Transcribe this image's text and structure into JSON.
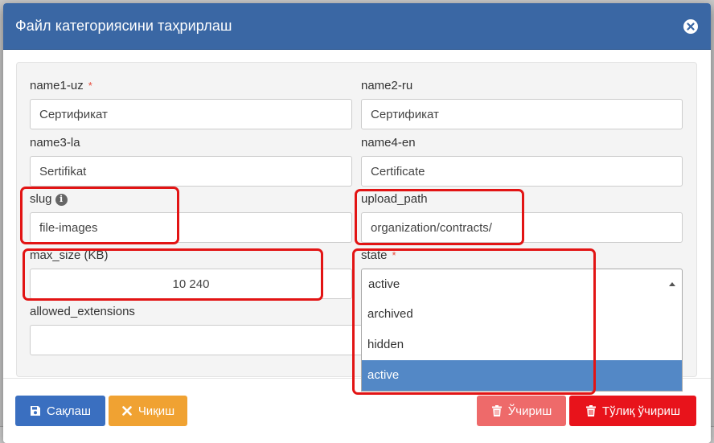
{
  "modal": {
    "title": "Файл категориясини таҳрирлаш"
  },
  "form": {
    "name1_uz": {
      "label": "name1-uz",
      "required": "*",
      "value": "Сертификат"
    },
    "name2_ru": {
      "label": "name2-ru",
      "value": "Сертификат"
    },
    "name3_la": {
      "label": "name3-la",
      "value": "Sertifikat"
    },
    "name4_en": {
      "label": "name4-en",
      "value": "Certificate"
    },
    "slug": {
      "label": "slug",
      "info": "i",
      "value": "file-images"
    },
    "upload_path": {
      "label": "upload_path",
      "value": "organization/contracts/"
    },
    "max_size": {
      "label": "max_size (KB)",
      "value": "10 240"
    },
    "state": {
      "label": "state",
      "required": "*",
      "value": "active",
      "options": [
        "archived",
        "hidden",
        "active"
      ],
      "selected": "active"
    },
    "allowed_extensions": {
      "label": "allowed_extensions",
      "value": ""
    }
  },
  "footer": {
    "save_label": "Сақлаш",
    "exit_label": "Чиқиш",
    "delete_label": "Ўчириш",
    "hard_delete_label": "Тўлиқ ўчириш"
  },
  "colors": {
    "header": "#3a67a4",
    "save": "#3a6fc0",
    "exit": "#f0a232",
    "delete": "#ee6a6a",
    "hard_delete": "#e8131b",
    "highlight": "#e21414",
    "selected_option": "#5388c6"
  }
}
